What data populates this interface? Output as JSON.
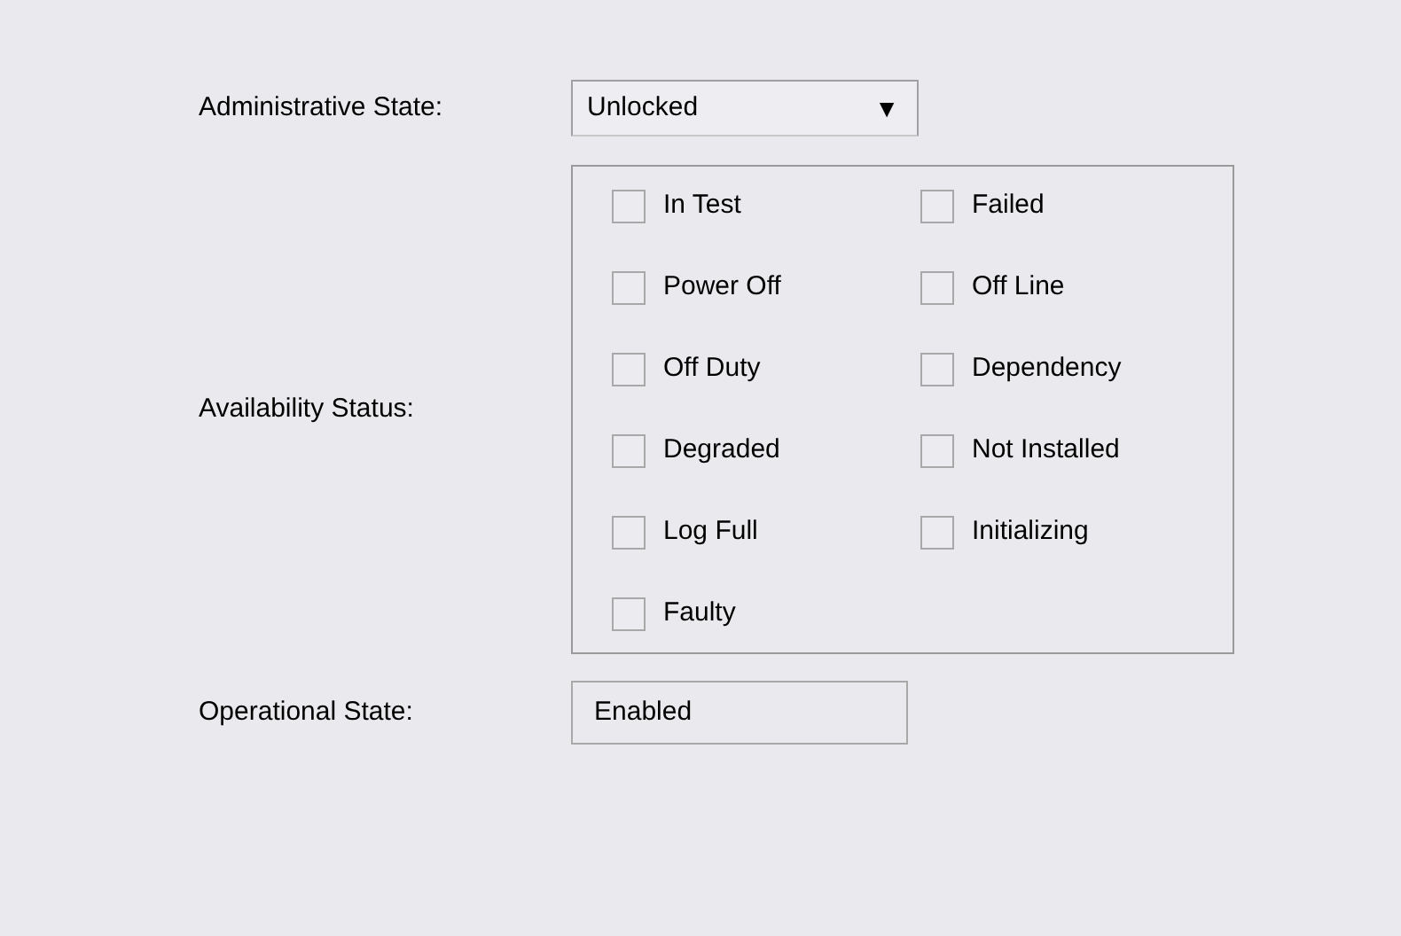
{
  "administrative_state": {
    "label": "Administrative State:",
    "value": "Unlocked",
    "arrow": "▼"
  },
  "availability_status": {
    "label": "Availability Status:",
    "options": [
      {
        "label": "In Test",
        "checked": false
      },
      {
        "label": "Failed",
        "checked": false
      },
      {
        "label": "Power Off",
        "checked": false
      },
      {
        "label": "Off Line",
        "checked": false
      },
      {
        "label": "Off Duty",
        "checked": false
      },
      {
        "label": "Dependency",
        "checked": false
      },
      {
        "label": "Degraded",
        "checked": false
      },
      {
        "label": "Not Installed",
        "checked": false
      },
      {
        "label": "Log Full",
        "checked": false
      },
      {
        "label": "Initializing",
        "checked": false
      },
      {
        "label": "Faulty",
        "checked": false
      }
    ]
  },
  "operational_state": {
    "label": "Operational State:",
    "value": "Enabled"
  }
}
